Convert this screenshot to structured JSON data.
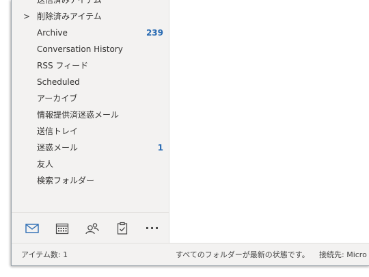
{
  "folders": [
    {
      "label": "送信済みアイテム",
      "count": "",
      "expander": ""
    },
    {
      "label": "削除済みアイテム",
      "count": "",
      "expander": ">"
    },
    {
      "label": "Archive",
      "count": "239",
      "expander": ""
    },
    {
      "label": "Conversation History",
      "count": "",
      "expander": ""
    },
    {
      "label": "RSS フィード",
      "count": "",
      "expander": ""
    },
    {
      "label": "Scheduled",
      "count": "",
      "expander": ""
    },
    {
      "label": "アーカイブ",
      "count": "",
      "expander": ""
    },
    {
      "label": "情報提供済迷惑メール",
      "count": "",
      "expander": ""
    },
    {
      "label": "送信トレイ",
      "count": "",
      "expander": ""
    },
    {
      "label": "迷惑メール",
      "count": "1",
      "expander": ""
    },
    {
      "label": "友人",
      "count": "",
      "expander": ""
    },
    {
      "label": "検索フォルダー",
      "count": "",
      "expander": ""
    }
  ],
  "navbar": {
    "items": [
      "mail-icon",
      "calendar-icon",
      "people-icon",
      "tasks-icon",
      "more-icon"
    ],
    "more_label": "···",
    "accent": "#2b6cb3"
  },
  "status": {
    "items": "アイテム数: 1",
    "all_folders": "すべてのフォルダーが最新の状態です。",
    "connection": "接続先: Micro"
  }
}
